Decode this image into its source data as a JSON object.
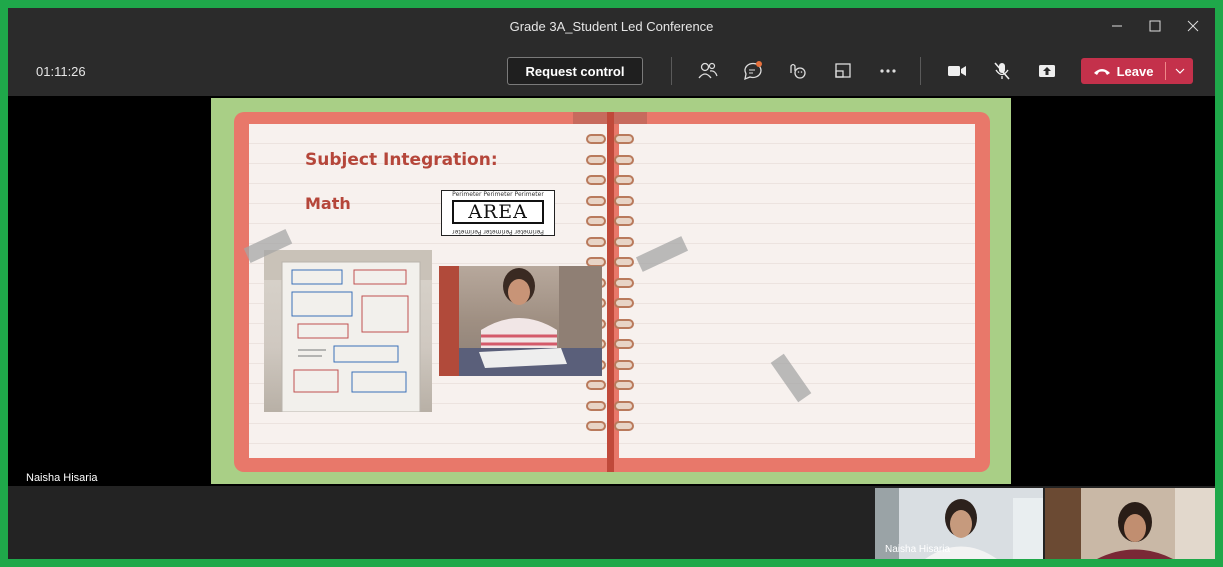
{
  "window": {
    "title": "Grade 3A_Student Led Conference"
  },
  "toolbar": {
    "timer": "01:11:26",
    "request_control_label": "Request control",
    "leave_label": "Leave",
    "icons": [
      "participants-icon",
      "chat-icon",
      "reactions-icon",
      "rooms-icon",
      "more-icon",
      "camera-icon",
      "mic-off-icon",
      "hand-icon",
      "share-icon"
    ],
    "leave_color": "#c4314b"
  },
  "slide": {
    "title": "Subject Integration:",
    "subtitle": "Math",
    "logo_word": "AREA",
    "logo_border_text": "Perimeter Perimeter Perimeter"
  },
  "stage": {
    "speaker_name": "Naisha Hisaria"
  },
  "participants": [
    {
      "name": "Naisha Hisaria"
    },
    {
      "name": ""
    }
  ],
  "colors": {
    "frame_border": "#1fa84a",
    "slide_bg": "#a9cf86",
    "notebook": "#e8786a",
    "title_red": "#b5463a"
  }
}
